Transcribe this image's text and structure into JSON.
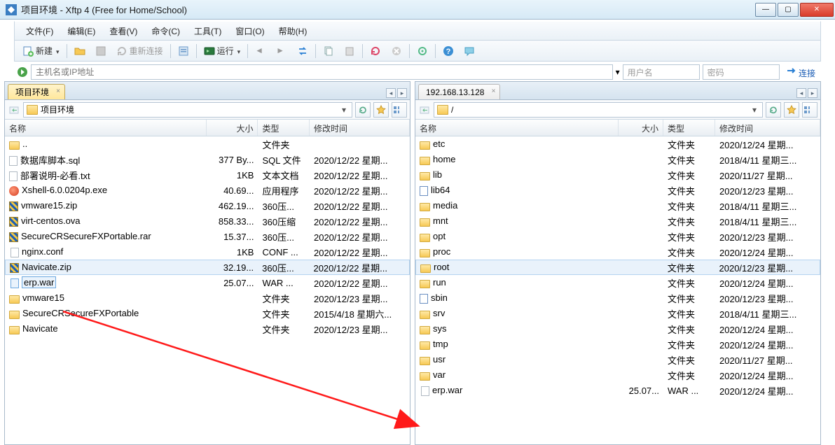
{
  "window": {
    "title": "项目环境 - Xftp 4 (Free for Home/School)"
  },
  "menu": {
    "file": "文件(F)",
    "edit": "编辑(E)",
    "view": "查看(V)",
    "command": "命令(C)",
    "tools": "工具(T)",
    "window": "窗口(O)",
    "help": "帮助(H)"
  },
  "toolbar": {
    "new": "新建",
    "reconnect": "重新连接",
    "run": "运行"
  },
  "addr": {
    "host_placeholder": "主机名或IP地址",
    "user_placeholder": "用户名",
    "pass_placeholder": "密码",
    "connect": "连接"
  },
  "left": {
    "tab": "项目环境",
    "path": "项目环境",
    "columns": {
      "name": "名称",
      "size": "大小",
      "type": "类型",
      "time": "修改时间"
    },
    "rows": [
      {
        "icon": "folder",
        "name": "..",
        "size": "",
        "type": "文件夹",
        "time": ""
      },
      {
        "icon": "sql",
        "name": "数据库脚本.sql",
        "size": "377 By...",
        "type": "SQL 文件",
        "time": "2020/12/22 星期..."
      },
      {
        "icon": "txt",
        "name": "部署说明-必看.txt",
        "size": "1KB",
        "type": "文本文档",
        "time": "2020/12/22 星期..."
      },
      {
        "icon": "exe",
        "name": "Xshell-6.0.0204p.exe",
        "size": "40.69...",
        "type": "应用程序",
        "time": "2020/12/22 星期..."
      },
      {
        "icon": "zip",
        "name": "vmware15.zip",
        "size": "462.19...",
        "type": "360压...",
        "time": "2020/12/22 星期..."
      },
      {
        "icon": "zip",
        "name": "virt-centos.ova",
        "size": "858.33...",
        "type": "360压缩",
        "time": "2020/12/22 星期..."
      },
      {
        "icon": "zip",
        "name": "SecureCRSecureFXPortable.rar",
        "size": "15.37...",
        "type": "360压...",
        "time": "2020/12/22 星期..."
      },
      {
        "icon": "file",
        "name": "nginx.conf",
        "size": "1KB",
        "type": "CONF ...",
        "time": "2020/12/22 星期..."
      },
      {
        "icon": "zip",
        "name": "Navicate.zip",
        "size": "32.19...",
        "type": "360压...",
        "time": "2020/12/22 星期...",
        "selected": true
      },
      {
        "icon": "file",
        "name": "erp.war",
        "size": "25.07...",
        "type": "WAR ...",
        "time": "2020/12/22 星期...",
        "renaming": true
      },
      {
        "icon": "folder",
        "name": "vmware15",
        "size": "",
        "type": "文件夹",
        "time": "2020/12/23 星期..."
      },
      {
        "icon": "folder",
        "name": "SecureCRSecureFXPortable",
        "size": "",
        "type": "文件夹",
        "time": "2015/4/18 星期六..."
      },
      {
        "icon": "folder",
        "name": "Navicate",
        "size": "",
        "type": "文件夹",
        "time": "2020/12/23 星期..."
      }
    ]
  },
  "right": {
    "tab": "192.168.13.128",
    "path": "/",
    "columns": {
      "name": "名称",
      "size": "大小",
      "type": "类型",
      "time": "修改时间"
    },
    "rows": [
      {
        "icon": "folder",
        "name": "etc",
        "size": "",
        "type": "文件夹",
        "time": "2020/12/24 星期..."
      },
      {
        "icon": "folder",
        "name": "home",
        "size": "",
        "type": "文件夹",
        "time": "2018/4/11 星期三..."
      },
      {
        "icon": "folder",
        "name": "lib",
        "size": "",
        "type": "文件夹",
        "time": "2020/11/27 星期..."
      },
      {
        "icon": "link",
        "name": "lib64",
        "size": "",
        "type": "文件夹",
        "time": "2020/12/23 星期..."
      },
      {
        "icon": "folder",
        "name": "media",
        "size": "",
        "type": "文件夹",
        "time": "2018/4/11 星期三..."
      },
      {
        "icon": "folder",
        "name": "mnt",
        "size": "",
        "type": "文件夹",
        "time": "2018/4/11 星期三..."
      },
      {
        "icon": "folder",
        "name": "opt",
        "size": "",
        "type": "文件夹",
        "time": "2020/12/23 星期..."
      },
      {
        "icon": "folder",
        "name": "proc",
        "size": "",
        "type": "文件夹",
        "time": "2020/12/24 星期..."
      },
      {
        "icon": "folder",
        "name": "root",
        "size": "",
        "type": "文件夹",
        "time": "2020/12/23 星期...",
        "selected": true
      },
      {
        "icon": "folder",
        "name": "run",
        "size": "",
        "type": "文件夹",
        "time": "2020/12/24 星期..."
      },
      {
        "icon": "link",
        "name": "sbin",
        "size": "",
        "type": "文件夹",
        "time": "2020/12/23 星期..."
      },
      {
        "icon": "folder",
        "name": "srv",
        "size": "",
        "type": "文件夹",
        "time": "2018/4/11 星期三..."
      },
      {
        "icon": "folder",
        "name": "sys",
        "size": "",
        "type": "文件夹",
        "time": "2020/12/24 星期..."
      },
      {
        "icon": "folder",
        "name": "tmp",
        "size": "",
        "type": "文件夹",
        "time": "2020/12/24 星期..."
      },
      {
        "icon": "folder",
        "name": "usr",
        "size": "",
        "type": "文件夹",
        "time": "2020/11/27 星期..."
      },
      {
        "icon": "folder",
        "name": "var",
        "size": "",
        "type": "文件夹",
        "time": "2020/12/24 星期..."
      },
      {
        "icon": "file",
        "name": "erp.war",
        "size": "25.07...",
        "type": "WAR ...",
        "time": "2020/12/24 星期..."
      }
    ]
  }
}
